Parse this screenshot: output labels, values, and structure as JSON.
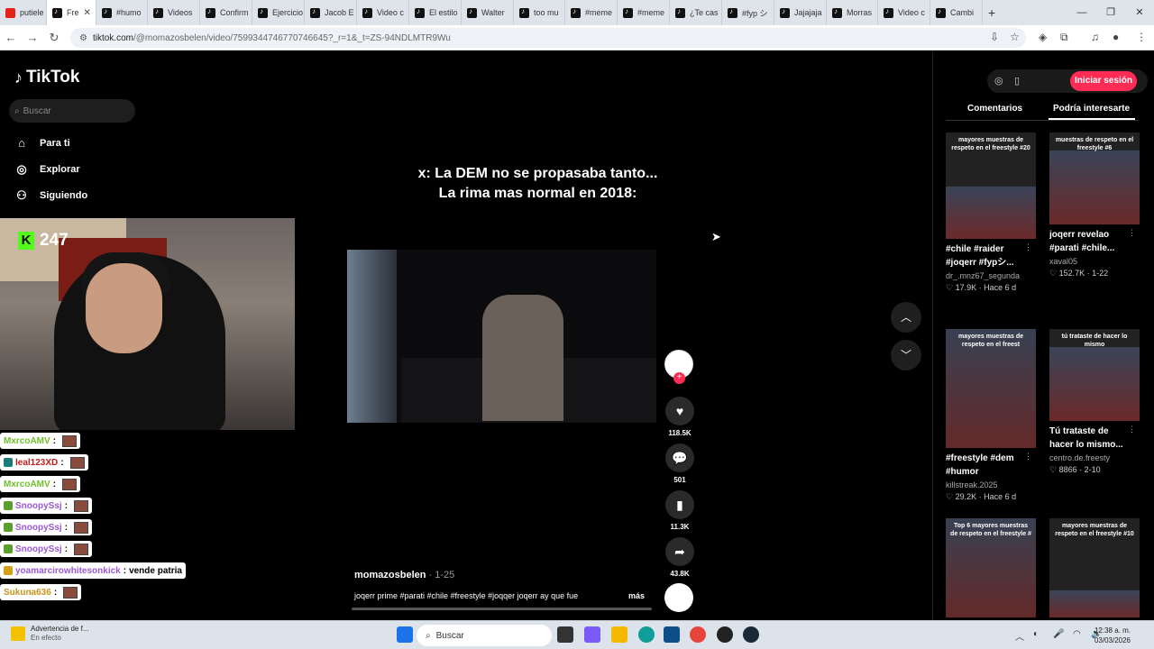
{
  "browser": {
    "tabs": [
      {
        "label": "putiele",
        "icon": "youtube-icon"
      },
      {
        "label": "Fre",
        "icon": "tiktok-icon",
        "active": true
      },
      {
        "label": "#humo",
        "icon": "tiktok-icon"
      },
      {
        "label": "Videos",
        "icon": "tiktok-icon"
      },
      {
        "label": "Confirm",
        "icon": "tiktok-icon"
      },
      {
        "label": "Ejercicio",
        "icon": "tiktok-icon"
      },
      {
        "label": "Jacob E",
        "icon": "tiktok-icon"
      },
      {
        "label": "Video c",
        "icon": "tiktok-icon"
      },
      {
        "label": "El estilo",
        "icon": "tiktok-icon"
      },
      {
        "label": "Walter",
        "icon": "tiktok-icon"
      },
      {
        "label": "too mu",
        "icon": "tiktok-icon"
      },
      {
        "label": "#meme",
        "icon": "tiktok-icon"
      },
      {
        "label": "#meme",
        "icon": "tiktok-icon"
      },
      {
        "label": "¿Te cas",
        "icon": "tiktok-icon"
      },
      {
        "label": "#fyp シ",
        "icon": "tiktok-icon"
      },
      {
        "label": "Jajajaja",
        "icon": "tiktok-icon"
      },
      {
        "label": "Morras",
        "icon": "tiktok-icon"
      },
      {
        "label": "Video c",
        "icon": "tiktok-icon"
      },
      {
        "label": "Cambi",
        "icon": "tiktok-icon"
      }
    ],
    "url_host": "tiktok.com",
    "url_rest": "/@momazosbelen/video/7599344746770746645?_r=1&_t=ZS-94NDLMTR9Wu"
  },
  "sidebar": {
    "logo": "TikTok",
    "search_placeholder": "Buscar",
    "nav": [
      {
        "label": "Para ti",
        "icon": "home-icon"
      },
      {
        "label": "Explorar",
        "icon": "compass-icon"
      },
      {
        "label": "Siguiendo",
        "icon": "user-icon"
      }
    ]
  },
  "stream": {
    "kick_count": "247",
    "chat": [
      {
        "user": "MxrcoAMV",
        "color": "#6fbf2e",
        "badge": "",
        "sep": ":",
        "msg": ""
      },
      {
        "user": "leal123XD",
        "color": "#c02020",
        "badge": "#1b7a7a",
        "sep": ":",
        "msg": ""
      },
      {
        "user": "MxrcoAMV",
        "color": "#6fbf2e",
        "badge": "",
        "sep": ":",
        "msg": ""
      },
      {
        "user": "SnoopySsj",
        "color": "#9b59d6",
        "badge": "#5aa02c",
        "sep": ":",
        "msg": ""
      },
      {
        "user": "SnoopySsj",
        "color": "#9b59d6",
        "badge": "#5aa02c",
        "sep": ":",
        "msg": ""
      },
      {
        "user": "SnoopySsj",
        "color": "#9b59d6",
        "badge": "#5aa02c",
        "sep": ":",
        "msg": ""
      },
      {
        "user": "yoamarcirowhitesonkick",
        "color": "#9b59d6",
        "badge": "#d4a017",
        "sep": ":",
        "msg": "vende patria"
      },
      {
        "user": "Sukuna636",
        "color": "#c8921a",
        "badge": "",
        "sep": ":",
        "msg": ""
      }
    ]
  },
  "video": {
    "caption_line1": "x: La DEM no se propasaba tanto...",
    "caption_line2": "La rima mas normal en 2018:",
    "author": "momazosbelen",
    "date": "· 1-25",
    "description": "joqerr prime #parati #chile #freestyle #joqqer joqerr ay que fue",
    "more": "más",
    "likes": "118.5K",
    "comments": "501",
    "saves": "11.3K",
    "shares": "43.8K"
  },
  "right": {
    "login": "Iniciar sesión",
    "tab_comments": "Comentarios",
    "tab_suggested": "Podría interesarte",
    "cards": [
      {
        "thumb_text": "mayores muestras de respeto en el freestyle #20",
        "title1": "#chile #raider",
        "title2": "#joqerr #fypシ...",
        "user": "dr_.mnz67_segunda",
        "stats": "♡ 17.9K · Hace 6 d"
      },
      {
        "thumb_text": "muestras de respeto en el freestyle #6",
        "title1": "joqerr revelao",
        "title2": "#parati #chile...",
        "user": "xaval05",
        "stats": "♡ 152.7K · 1-22"
      },
      {
        "thumb_text": "mayores muestras de respeto en el freest",
        "title1": "#freestyle #dem",
        "title2": "#humor",
        "user": "killstreak.2025",
        "stats": "♡ 29.2K · Hace 6 d"
      },
      {
        "thumb_text": "tú trataste de hacer lo mismo",
        "title1": "Tú trataste de",
        "title2": "hacer lo mismo...",
        "user": "centro.de.freesty",
        "stats": "♡ 8866 · 2-10"
      },
      {
        "thumb_text": "Top 6 mayores muestras de respeto en el freestyle #",
        "title1": "",
        "title2": "",
        "user": "",
        "stats": ""
      },
      {
        "thumb_text": "mayores muestras de respeto en el freestyle #10",
        "title1": "",
        "title2": "",
        "user": "",
        "stats": ""
      }
    ]
  },
  "taskbar": {
    "notif_title": "Advertencia de f...",
    "notif_sub": "En efecto",
    "search": "Buscar",
    "time": "12:38 a. m.",
    "date": "03/03/2026"
  }
}
